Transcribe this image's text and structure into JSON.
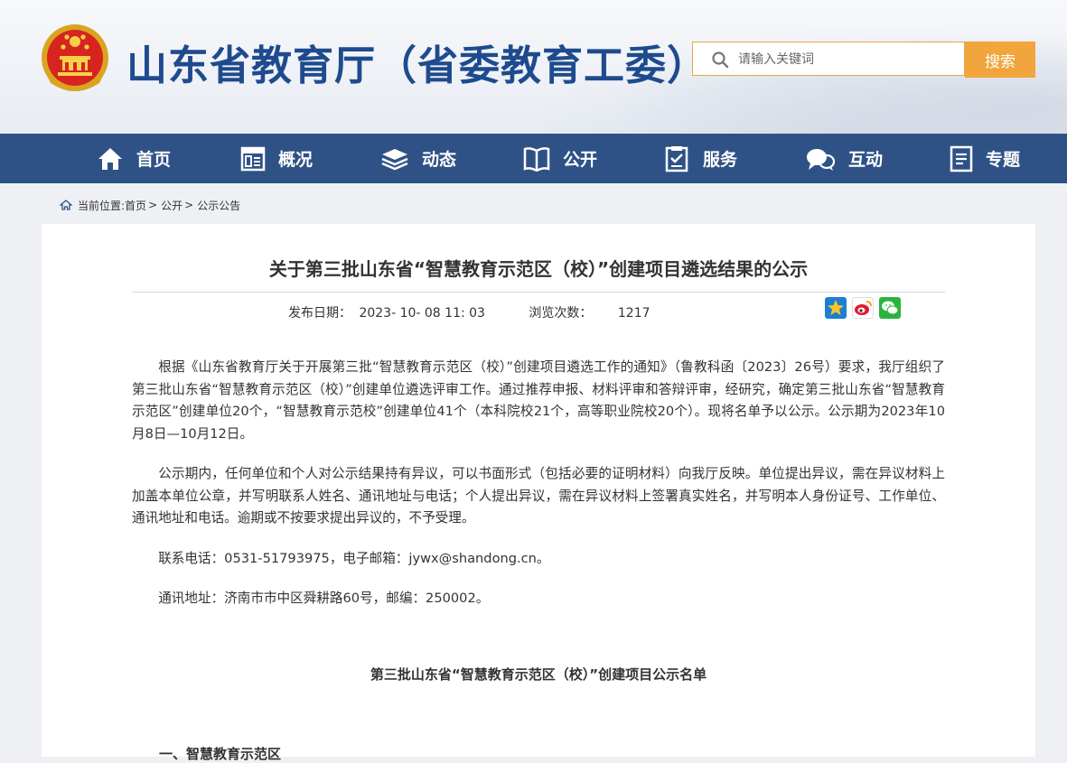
{
  "header": {
    "site_title": "山东省教育厅（省委教育工委）",
    "search_placeholder": "请输入关键词",
    "search_button": "搜索"
  },
  "nav": {
    "items": [
      {
        "label": "首页",
        "icon": "home-icon"
      },
      {
        "label": "概况",
        "icon": "overview-icon"
      },
      {
        "label": "动态",
        "icon": "news-icon"
      },
      {
        "label": "公开",
        "icon": "book-icon"
      },
      {
        "label": "服务",
        "icon": "service-icon"
      },
      {
        "label": "互动",
        "icon": "chat-icon"
      },
      {
        "label": "专题",
        "icon": "topic-icon"
      }
    ]
  },
  "breadcrumb": {
    "prefix": "当前位置:",
    "items": [
      "首页",
      "公开",
      "公示公告"
    ]
  },
  "article": {
    "title": "关于第三批山东省“智慧教育示范区（校）”创建项目遴选结果的公示",
    "date_label": "发布日期：",
    "date_value": "2023- 10- 08 11: 03",
    "views_label": "浏览次数：",
    "views_value": "1217",
    "paragraphs": [
      "根据《山东省教育厅关于开展第三批“智慧教育示范区（校）”创建项目遴选工作的通知》（鲁教科函〔2023〕26号）要求，我厅组织了第三批山东省“智慧教育示范区（校）”创建单位遴选评审工作。通过推荐申报、材料评审和答辩评审，经研究，确定第三批山东省“智慧教育示范区”创建单位20个，“智慧教育示范校”创建单位41个（本科院校21个，高等职业院校20个）。现将名单予以公示。公示期为2023年10月8日—10月12日。",
      "公示期内，任何单位和个人对公示结果持有异议，可以书面形式（包括必要的证明材料）向我厅反映。单位提出异议，需在异议材料上加盖本单位公章，并写明联系人姓名、通讯地址与电话；个人提出异议，需在异议材料上签署真实姓名，并写明本人身份证号、工作单位、通讯地址和电话。逾期或不按要求提出异议的，不予受理。",
      "联系电话：0531-51793975，电子邮箱：jywx@shandong.cn。",
      "通讯地址：济南市市中区舜耕路60号，邮编：250002。"
    ],
    "subtitle": "第三批山东省“智慧教育示范区（校）”创建项目公示名单",
    "section_heading": "一、智慧教育示范区"
  },
  "colors": {
    "nav_bg": "#2f5286",
    "title_blue": "#1e4b8e",
    "search_orange": "#f1a53a"
  }
}
